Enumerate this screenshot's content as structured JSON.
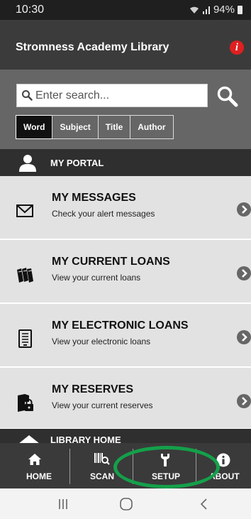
{
  "status_bar": {
    "time": "10:30",
    "battery": "94%",
    "icons": [
      "wifi-icon",
      "signal-icon",
      "battery-icon"
    ]
  },
  "app": {
    "title": "Stromness Academy Library",
    "info_icon": "info-icon"
  },
  "search": {
    "placeholder": "Enter search...",
    "value": "",
    "filters": [
      {
        "label": "Word",
        "active": true
      },
      {
        "label": "Subject",
        "active": false
      },
      {
        "label": "Title",
        "active": false
      },
      {
        "label": "Author",
        "active": false
      }
    ]
  },
  "portal": {
    "header": "MY PORTAL",
    "items": [
      {
        "title": "MY MESSAGES",
        "subtitle": "Check your alert messages",
        "icon": "envelope-icon"
      },
      {
        "title": "MY CURRENT LOANS",
        "subtitle": "View your current loans",
        "icon": "books-icon"
      },
      {
        "title": "MY ELECTRONIC LOANS",
        "subtitle": "View your electronic loans",
        "icon": "ereader-icon"
      },
      {
        "title": "MY RESERVES",
        "subtitle": "View your current reserves",
        "icon": "locked-book-icon"
      }
    ],
    "next_section": "LIBRARY HOME"
  },
  "bottom_nav": {
    "items": [
      {
        "label": "HOME",
        "icon": "home-icon"
      },
      {
        "label": "SCAN",
        "icon": "barcode-scan-icon"
      },
      {
        "label": "SETUP",
        "icon": "wrench-icon"
      },
      {
        "label": "ABOUT",
        "icon": "info-icon"
      }
    ],
    "highlight_color": "#14a04a"
  },
  "colors": {
    "header_bg": "#3b3b3b",
    "search_bg": "#666666",
    "item_bg": "#e2e2e2",
    "badge_red": "#e02020"
  }
}
